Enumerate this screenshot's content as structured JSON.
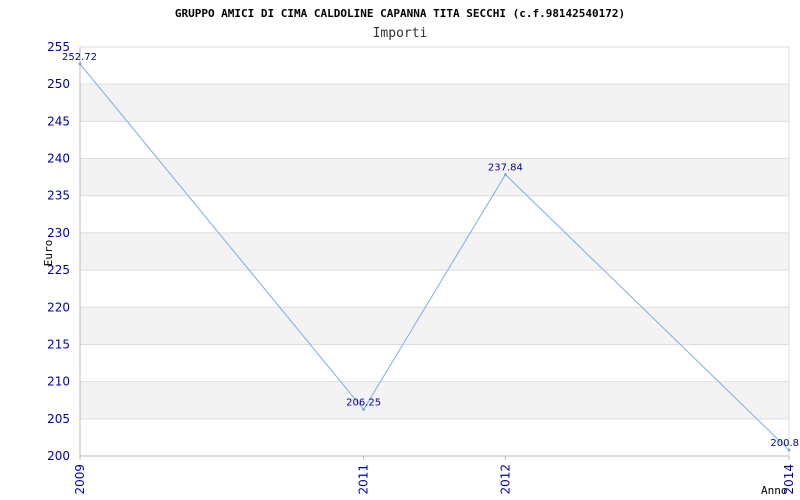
{
  "chart_data": {
    "type": "line",
    "title": "GRUPPO AMICI DI CIMA CALDOLINE CAPANNA TITA SECCHI (c.f.98142540172)",
    "subtitle": "Importi",
    "xlabel": "Anno",
    "ylabel": "Euro",
    "x": [
      "2009",
      "2011",
      "2012",
      "2014"
    ],
    "x_values": [
      2009,
      2011,
      2012,
      2014
    ],
    "xlim": [
      2009,
      2014
    ],
    "ylim": [
      200,
      255
    ],
    "yticks": [
      "200",
      "205",
      "210",
      "215",
      "220",
      "225",
      "230",
      "235",
      "240",
      "245",
      "250",
      "255"
    ],
    "ytick_values": [
      200,
      205,
      210,
      215,
      220,
      225,
      230,
      235,
      240,
      245,
      250,
      255
    ],
    "series": [
      {
        "values": [
          252.72,
          206.25,
          237.84,
          200.8
        ],
        "labels": [
          "252.72",
          "206.25",
          "237.84",
          "200.8"
        ]
      }
    ],
    "grid": true,
    "colors": {
      "line": "#7aaeea",
      "tick_text": "#0000aa",
      "band": "#f3f3f3",
      "gridline": "#dddddd",
      "axis": "#bbbbbb"
    }
  }
}
